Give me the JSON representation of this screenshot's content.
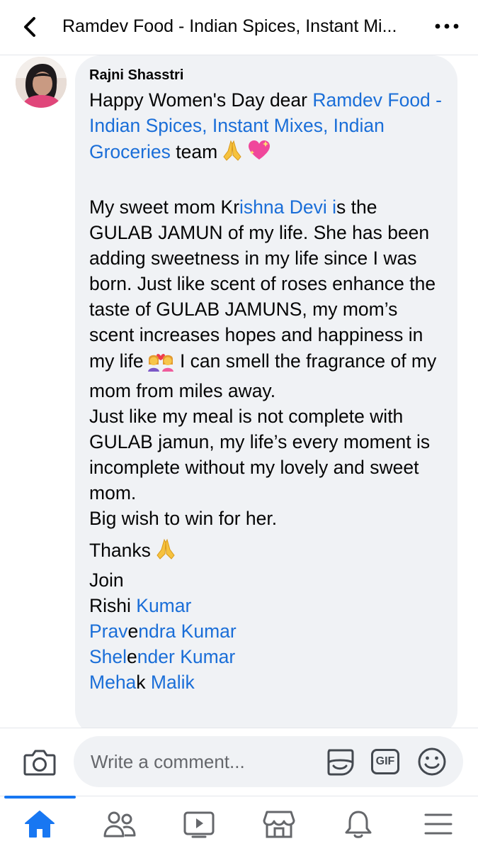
{
  "header": {
    "title": "Ramdev Food - Indian Spices, Instant Mi..."
  },
  "comment": {
    "author": "Rajni Shasstri",
    "line1_text": "Happy Women's Day dear ",
    "line1_link": "Ramdev Food - Indian Spices, Instant Mixes, Indian Groceries",
    "line1_end": " team",
    "p2_a": "My sweet mom Kr",
    "p2_link": "ishna Devi i",
    "p2_b": "s the GULAB JAMUN of my life. She has been adding sweetness in my life since I was born. Just like scent of roses enhance the taste of GULAB JAMUNS, my mom’s scent increases hopes and happiness in my life",
    "p2_c": " I can smell the fragrance of my mom from miles away.",
    "p3": "Just like my meal is not complete with GULAB jamun, my life’s every moment is incomplete without my lovely and sweet mom.",
    "p4": "Big wish to win for her.",
    "thanks": "Thanks",
    "join": "Join",
    "tag1_a": "Rishi ",
    "tag1_link": "Kumar",
    "tag2_link_a": "Prav",
    "tag2_plain": "e",
    "tag2_link_b": "ndra Kumar",
    "tag3_link_a": "Shel",
    "tag3_plain": "e",
    "tag3_link_b": "nder Kumar",
    "tag4_link_a": "Meha",
    "tag4_plain": "k ",
    "tag4_link_b": "Malik"
  },
  "composer": {
    "placeholder": "Write a comment...",
    "gif_label": "GIF"
  },
  "nav": {
    "items": [
      "home",
      "friends",
      "watch",
      "marketplace",
      "notifications",
      "menu"
    ],
    "active": "home"
  },
  "colors": {
    "link": "#1a6ed8",
    "accent": "#1877f2",
    "bubble": "#f0f2f5"
  }
}
